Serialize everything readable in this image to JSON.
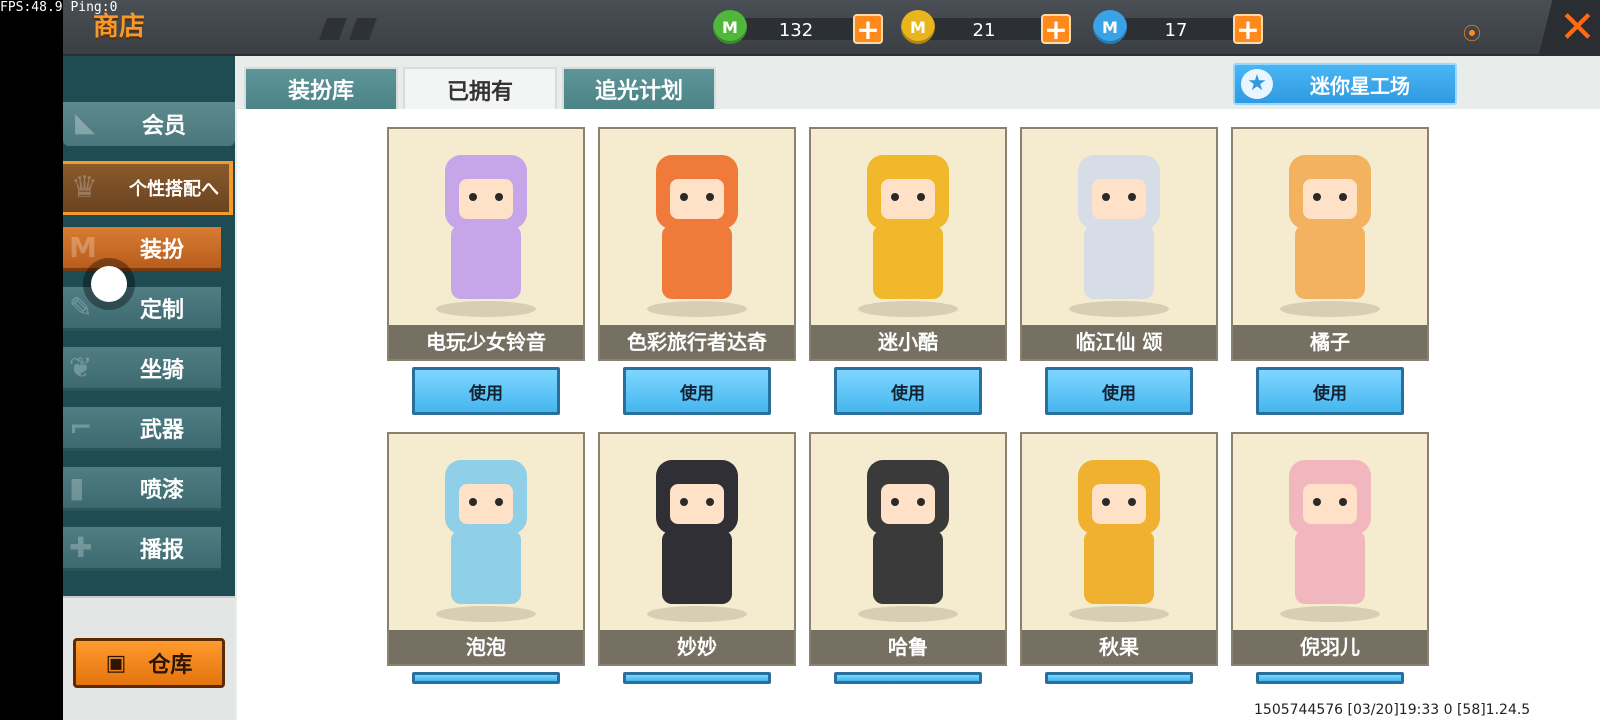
{
  "fps": "FPS:48.9  Ping:0",
  "title": "商店",
  "currencies": [
    {
      "icon": "green-gem-icon",
      "glyph": "M",
      "color": "#4fb83a",
      "value": "132"
    },
    {
      "icon": "gold-coin-icon",
      "glyph": "M",
      "color": "#e9b51c",
      "value": "21"
    },
    {
      "icon": "blue-star-coin-icon",
      "glyph": "M",
      "color": "#3aa3e8",
      "value": "17"
    }
  ],
  "sidebar": {
    "member": "会员",
    "parent": "个性搭配へ",
    "items": [
      "装扮",
      "定制",
      "坐骑",
      "武器",
      "喷漆",
      "播报"
    ],
    "warehouse": "仓库"
  },
  "tabs": [
    "装扮库",
    "已拥有",
    "追光计划"
  ],
  "studio_label": "迷你星工场",
  "use_label": "使用",
  "skins": [
    {
      "name": "电玩少女铃音",
      "color": "#c6a6e8"
    },
    {
      "name": "色彩旅行者达奇",
      "color": "#f07a3a"
    },
    {
      "name": "迷小酷",
      "color": "#f0b82a"
    },
    {
      "name": "临江仙 颂",
      "color": "#d6dde6"
    },
    {
      "name": "橘子",
      "color": "#f2b260"
    },
    {
      "name": "泡泡",
      "color": "#8fd0e8"
    },
    {
      "name": "妙妙",
      "color": "#2f2f35"
    },
    {
      "name": "哈鲁",
      "color": "#3a3a3a"
    },
    {
      "name": "秋果",
      "color": "#f0b030"
    },
    {
      "name": "倪羽儿",
      "color": "#f2b6be"
    }
  ],
  "footer": "1505744576   [03/20]19:33 0   [58]1.24.5"
}
